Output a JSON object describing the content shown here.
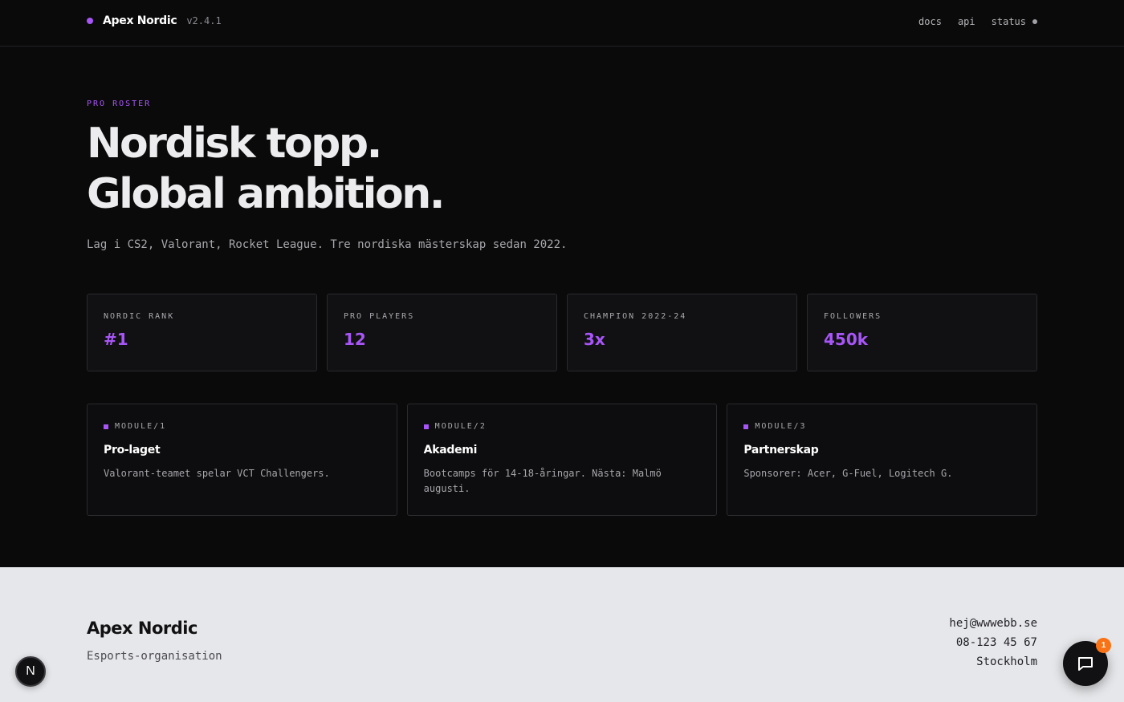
{
  "header": {
    "brand": "Apex Nordic",
    "version": "v2.4.1",
    "nav": [
      "docs",
      "api",
      "status"
    ]
  },
  "hero": {
    "eyebrow": "PRO ROSTER",
    "headline_1": "Nordisk topp.",
    "headline_2": "Global ambition.",
    "subline": "Lag i CS2, Valorant, Rocket League. Tre nordiska mästerskap sedan 2022."
  },
  "stats": [
    {
      "label": "NORDIC RANK",
      "value": "#1"
    },
    {
      "label": "PRO PLAYERS",
      "value": "12"
    },
    {
      "label": "CHAMPION 2022-24",
      "value": "3x"
    },
    {
      "label": "FOLLOWERS",
      "value": "450k"
    }
  ],
  "modules": [
    {
      "tag": "MODULE/1",
      "title": "Pro-laget",
      "desc": "Valorant-teamet spelar VCT Challengers."
    },
    {
      "tag": "MODULE/2",
      "title": "Akademi",
      "desc": "Bootcamps för 14-18-åringar. Nästa: Malmö augusti."
    },
    {
      "tag": "MODULE/3",
      "title": "Partnerskap",
      "desc": "Sponsorer: Acer, G-Fuel, Logitech G."
    }
  ],
  "footer": {
    "name": "Apex Nordic",
    "tagline": "Esports-organisation",
    "email": "hej@wwwebb.se",
    "phone": "08-123 45 67",
    "city": "Stockholm"
  },
  "widgets": {
    "n_badge": "N",
    "chat_count": "1"
  },
  "colors": {
    "accent": "#a855f7",
    "background": "#0a0a0b",
    "footer_bg": "#e6e7ea",
    "badge": "#f97316"
  }
}
